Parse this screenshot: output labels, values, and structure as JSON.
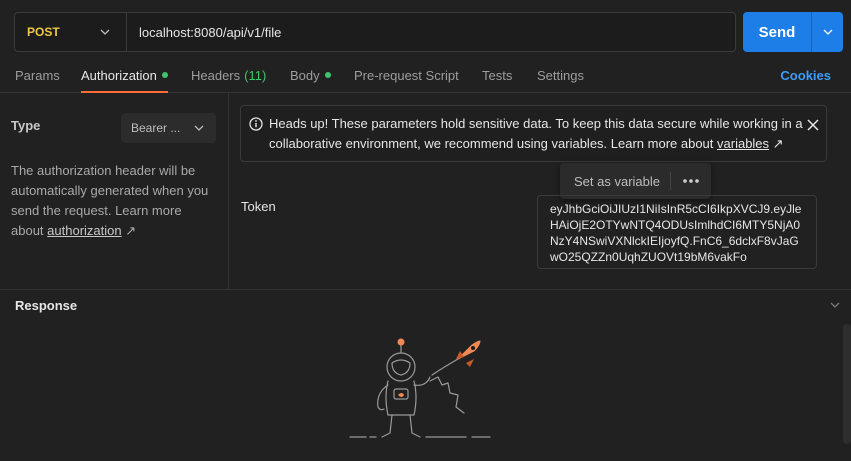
{
  "request": {
    "method": "POST",
    "url": "localhost:8080/api/v1/file",
    "send_label": "Send"
  },
  "tabs": [
    {
      "label": "Params"
    },
    {
      "label": "Authorization"
    },
    {
      "label": "Headers",
      "count": "(11)"
    },
    {
      "label": "Body"
    },
    {
      "label": "Pre-request Script"
    },
    {
      "label": "Tests"
    },
    {
      "label": "Settings"
    }
  ],
  "cookies_label": "Cookies",
  "auth": {
    "type_label": "Type",
    "type_value": "Bearer ...",
    "description": "The authorization header will be automatically generated when you send the request. Learn more about ",
    "description_link": "authorization",
    "link_arrow": "↗"
  },
  "alert": {
    "text": "Heads up! These parameters hold sensitive data. To keep this data secure while working in a collaborative environment, we recommend using variables. Learn more about ",
    "link": "variables",
    "link_arrow": "↗"
  },
  "popup": {
    "label": "Set as variable",
    "more": "•••"
  },
  "token": {
    "label": "Token",
    "value": "eyJhbGciOiJIUzI1NiIsInR5cCI6IkpXVCJ9.eyJleHAiOjE2OTYwNTQ4ODUsImlhdCI6MTY5NjA0NzY4NSwiVXNlckIEIjoyfQ.FnC6_6dclxF8vJaGwO25QZZn0UqhZUOVt19bM6vakFo"
  },
  "response": {
    "title": "Response"
  },
  "colors": {
    "accent": "#ff6c37",
    "send": "#1d7ee8",
    "status_dot": "#3ec46d",
    "method": "#f0c548",
    "link": "#3d9bfa"
  }
}
